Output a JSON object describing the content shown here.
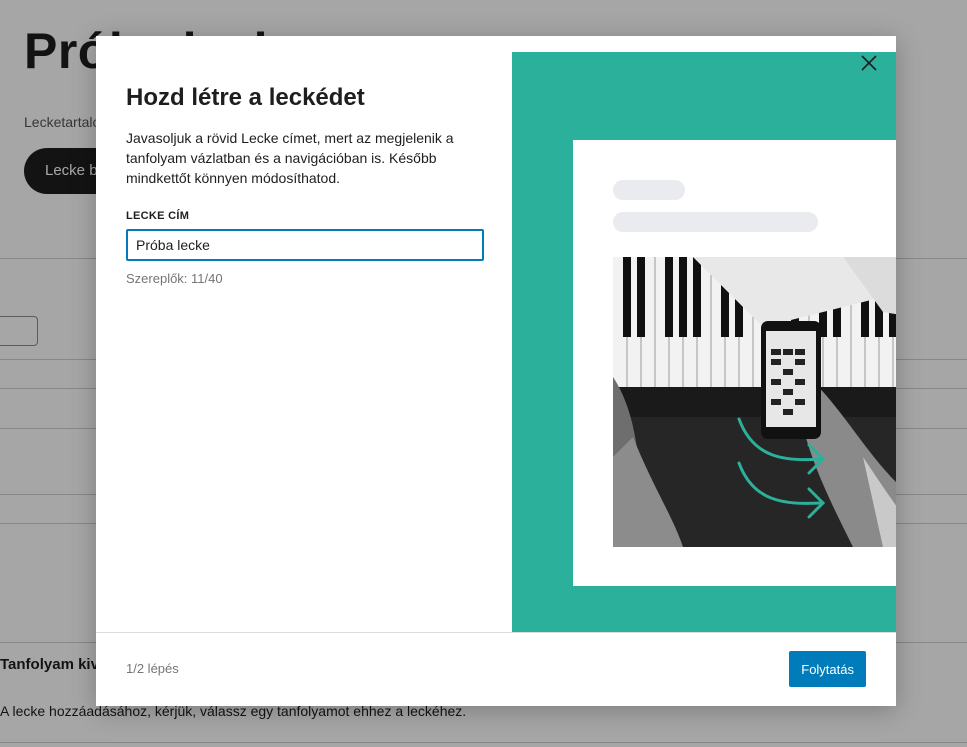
{
  "background": {
    "page_title": "Próba lecke",
    "subtitle": "Lecketartalom",
    "primary_button_label": "Lecke be",
    "section_label": "Tanfolyam kiválasztás",
    "section_text": "A lecke hozzáadásához, kérjük, válassz egy tanfolyamot ehhez a leckéhez."
  },
  "modal": {
    "title": "Hozd létre a leckédet",
    "description": "Javasoljuk a rövid Lecke címet, mert az megjelenik a tanfolyam vázlatban és a navigációban is. Később mindkettőt könnyen módosíthatod.",
    "field_label": "LECKE CÍM",
    "field_value": "Próba lecke",
    "char_count": "Szereplők: 11/40",
    "step": "1/2 lépés",
    "continue_label": "Folytatás",
    "close_icon": "close-icon"
  },
  "preview": {
    "accent_color": "#2bb19b",
    "image_icon": "piano-phone-illustration"
  },
  "colors": {
    "primary": "#007cba",
    "text": "#1e1e1e",
    "muted": "#757575",
    "accent": "#2bb19b"
  }
}
